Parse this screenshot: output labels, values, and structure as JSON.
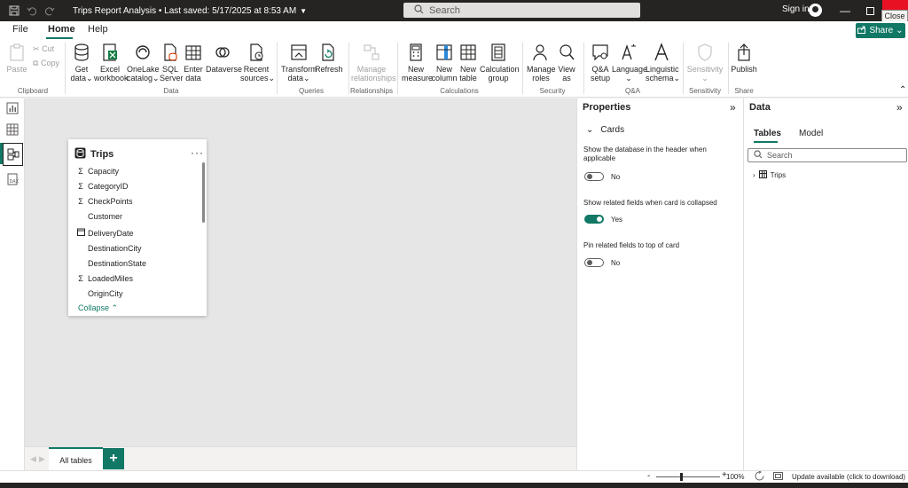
{
  "window": {
    "title": "Trips Report Analysis",
    "saved": "Last saved: 5/17/2025 at 8:53 AM",
    "search_placeholder": "Search",
    "signin": "Sign in",
    "close_tooltip": "Close"
  },
  "menu_tabs": [
    {
      "label": "File"
    },
    {
      "label": "Home",
      "active": true
    },
    {
      "label": "Help"
    }
  ],
  "share_label": "Share",
  "ribbon": {
    "clipboard": {
      "label": "Clipboard",
      "paste": "Paste",
      "cut": "Cut",
      "copy": "Copy"
    },
    "data": {
      "label": "Data",
      "buttons": [
        {
          "l1": "Get",
          "l2": "data",
          "icon": "database-icon",
          "dropdown": true
        },
        {
          "l1": "Excel",
          "l2": "workbook",
          "icon": "excel-icon"
        },
        {
          "l1": "OneLake",
          "l2": "catalog",
          "icon": "onelake-icon",
          "dropdown": true
        },
        {
          "l1": "SQL",
          "l2": "Server",
          "icon": "sql-server-icon"
        },
        {
          "l1": "Enter",
          "l2": "data",
          "icon": "table-grid-icon"
        },
        {
          "l1": "Dataverse",
          "l2": "",
          "icon": "dataverse-icon"
        },
        {
          "l1": "Recent",
          "l2": "sources",
          "icon": "recent-sources-icon",
          "dropdown": true
        }
      ]
    },
    "queries": {
      "label": "Queries",
      "buttons": [
        {
          "l1": "Transform",
          "l2": "data",
          "icon": "transform-icon",
          "dropdown": true
        },
        {
          "l1": "Refresh",
          "l2": "",
          "icon": "refresh-icon"
        }
      ]
    },
    "relationships": {
      "label": "Relationships",
      "button": {
        "l1": "Manage",
        "l2": "relationships"
      }
    },
    "calculations": {
      "label": "Calculations",
      "buttons": [
        {
          "l1": "New",
          "l2": "measure",
          "icon": "calculator-icon"
        },
        {
          "l1": "New",
          "l2": "column",
          "icon": "column-icon"
        },
        {
          "l1": "New",
          "l2": "table",
          "icon": "table-icon"
        },
        {
          "l1": "Calculation",
          "l2": "group",
          "icon": "calculation-group-icon"
        }
      ]
    },
    "security": {
      "label": "Security",
      "buttons": [
        {
          "l1": "Manage",
          "l2": "roles",
          "icon": "manage-roles-icon"
        },
        {
          "l1": "View",
          "l2": "as",
          "icon": "view-as-icon"
        }
      ]
    },
    "qa": {
      "label": "Q&A",
      "buttons": [
        {
          "l1": "Q&A",
          "l2": "setup",
          "icon": "qa-setup-icon"
        },
        {
          "l1": "Language",
          "l2": "",
          "icon": "language-icon",
          "dropdown": true
        },
        {
          "l1": "Linguistic",
          "l2": "schema",
          "icon": "linguistic-icon",
          "dropdown": true
        }
      ]
    },
    "sensitivity": {
      "label": "Sensitivity",
      "button": {
        "l1": "Sensitivity",
        "l2": ""
      }
    },
    "share": {
      "label": "Share",
      "button": {
        "l1": "Publish",
        "l2": ""
      }
    }
  },
  "card": {
    "title": "Trips",
    "fields": [
      {
        "name": "Capacity",
        "icon": "sigma"
      },
      {
        "name": "CategoryID",
        "icon": "sigma"
      },
      {
        "name": "CheckPoints",
        "icon": "sigma"
      },
      {
        "name": "Customer",
        "icon": ""
      },
      {
        "name": "DeliveryDate",
        "icon": "calendar"
      },
      {
        "name": "DestinationCity",
        "icon": ""
      },
      {
        "name": "DestinationState",
        "icon": ""
      },
      {
        "name": "LoadedMiles",
        "icon": "sigma"
      },
      {
        "name": "OriginCity",
        "icon": ""
      }
    ],
    "collapse_label": "Collapse"
  },
  "bottom_tabs": {
    "all_tables": "All tables"
  },
  "properties": {
    "title": "Properties",
    "section": "Cards",
    "items": [
      {
        "label": "Show the database in the header when applicable",
        "value": "No",
        "on": false
      },
      {
        "label": "Show related fields when card is collapsed",
        "value": "Yes",
        "on": true
      },
      {
        "label": "Pin related fields to top of card",
        "value": "No",
        "on": false
      }
    ]
  },
  "data_pane": {
    "title": "Data",
    "tabs": [
      {
        "label": "Tables",
        "active": true
      },
      {
        "label": "Model"
      }
    ],
    "search_placeholder": "Search",
    "tables": [
      {
        "name": "Trips"
      }
    ]
  },
  "status": {
    "zoom": "100%",
    "zoom_level": 1.0,
    "update": "Update available (click to download)"
  },
  "colors": {
    "accent": "#117865",
    "titlebar": "#252423",
    "close": "#e81123"
  }
}
